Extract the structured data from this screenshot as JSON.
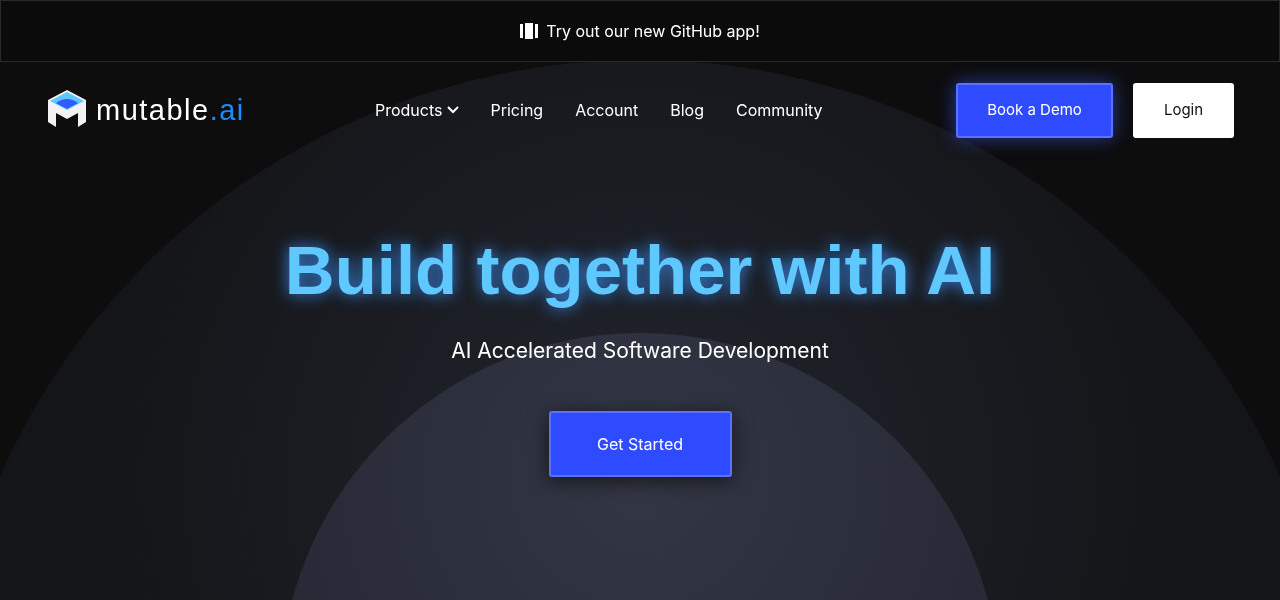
{
  "banner": {
    "text": "Try out our new GitHub app!"
  },
  "logo": {
    "name": "mutable",
    "suffix": ".ai"
  },
  "nav": [
    {
      "label": "Products",
      "has_menu": true
    },
    {
      "label": "Pricing",
      "has_menu": false
    },
    {
      "label": "Account",
      "has_menu": false
    },
    {
      "label": "Blog",
      "has_menu": false
    },
    {
      "label": "Community",
      "has_menu": false
    }
  ],
  "actions": [
    {
      "label": "Book a Demo",
      "kind": "primary"
    },
    {
      "label": "Login",
      "kind": "light"
    }
  ],
  "hero": {
    "title": "Build together with AI",
    "subtitle": "AI Accelerated Software Development",
    "cta": "Get Started"
  }
}
